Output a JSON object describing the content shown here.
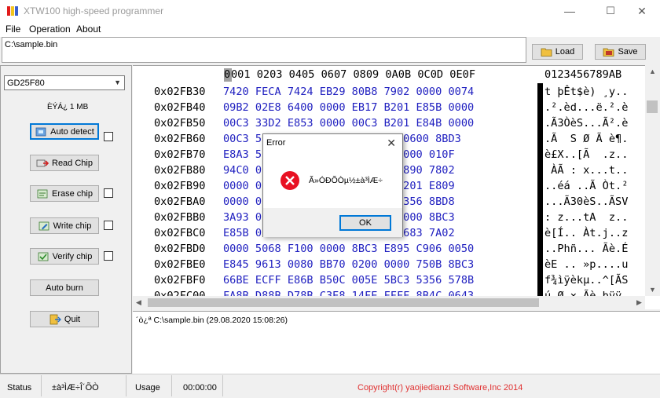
{
  "window": {
    "title": "XTW100 high-speed programmer",
    "minimize": "—",
    "maximize": "☐",
    "close": "✕"
  },
  "menu": {
    "items": [
      "File",
      "Operation",
      "About"
    ]
  },
  "path": {
    "value": "C:\\sample.bin"
  },
  "toolbar": {
    "load_label": "Load",
    "save_label": "Save"
  },
  "chip": {
    "selected": "GD25F80",
    "size_label": "ÈÝÁ¿ 1 MB"
  },
  "actions": {
    "auto_detect": "Auto detect",
    "read_chip": "Read Chip",
    "erase_chip": "Erase chip",
    "write_chip": "Write chip",
    "verify_chip": "Verify chip",
    "auto_burn": "Auto burn",
    "quit": "Quit"
  },
  "hex": {
    "header_first": "0",
    "header_columns": "001 0203 0405 0607 0809 0A0B 0C0D 0E0F",
    "header_ascii": "0123456789AB",
    "rows": [
      {
        "addr": "0x02FB30",
        "bytes": "7420 FECA 7424 EB29 80B8 7902 0000 0074",
        "ascii": "t þÊt$è) ¸y.."
      },
      {
        "addr": "0x02FB40",
        "bytes": "09B2 02E8 6400 0000 EB17 B201 E85B 0000",
        "ascii": ".².èd...ë.².è"
      },
      {
        "addr": "0x02FB50",
        "bytes": "00C3 33D2 E853 0000 00C3 B201 E84B 0000",
        "ascii": ".Ã3ÒèS...Ã².è"
      },
      {
        "addr": "0x02FB60",
        "bytes": "00C3 5F   0  0   B 8   B636 0600 8BD3",
        "ascii": ".Ã  S Ø Ã è¶."
      },
      {
        "addr": "0x02FB70",
        "bytes": "E8A3 5    8     0 8   7A02 0000 010F",
        "ascii": "è£X..[Ã  .z.."
      },
      {
        "addr": "0x02FB80",
        "bytes": "94C0 0    5     0 8   740B 8890 7802",
        "ascii": " ÀÃ : x...t.."
      },
      {
        "addr": "0x02FB90",
        "bytes": "0000 0    E     0 2   7408 B201 E809",
        "ascii": "..éá ..Ã Òt.²"
      },
      {
        "addr": "0x02FBA0",
        "bytes": "0000 0    0     0 0   00C3 5356 8BD8",
        "ascii": "...Ã30èS..ÃSV"
      },
      {
        "addr": "0x02FBB0",
        "bytes": "3A93 0    B     0 3   7A02 0000 8BC3",
        "ascii": ": z...tA  z.."
      },
      {
        "addr": "0x02FBC0",
        "bytes": "E85B 0    C     E 8 A 000F B683 7A02",
        "ascii": "è[Í.. Àt.j..z"
      },
      {
        "addr": "0x02FBD0",
        "bytes": "0000 5068 F100 0000 8BC3 E895 C906 0050",
        "ascii": "..Phñ... Ãè.É"
      },
      {
        "addr": "0x02FBE0",
        "bytes": "E845 9613 0080 BB70 0200 0000 750B 8BC3",
        "ascii": "èE .. »p....u"
      },
      {
        "addr": "0x02FBF0",
        "bytes": "66BE ECFF E86B B50C 005E 5BC3 5356 578B",
        "ascii": "f¾ìÿèkµ..^[ÃS"
      },
      {
        "addr": "0x02FC00",
        "bytes": "FA8B D88B D78B C3E8 14FE FFFF 8B4C 0643",
        "ascii": "ú Ø × Ãè.þÿÿ"
      }
    ]
  },
  "log": {
    "line": "´ò¿ª C:\\sample.bin (29.08.2020 15:08:26)"
  },
  "status": {
    "label": "Status",
    "state": "±à³ÌÆ÷Î´ÕÒ",
    "usage_label": "Usage",
    "time": "00:00:00",
    "copyright": "Copyright(r) yaojiedianzi Software,Inc 2014"
  },
  "dialog": {
    "title": "Error",
    "message": "Ã»ÓÐÕÒµ½±à³ÌÆ÷",
    "ok_label": "OK"
  },
  "colors": {
    "hex_bytes": "#2020c0",
    "copyright": "#e03030",
    "focus": "#0078d7",
    "error_icon": "#e81123"
  }
}
